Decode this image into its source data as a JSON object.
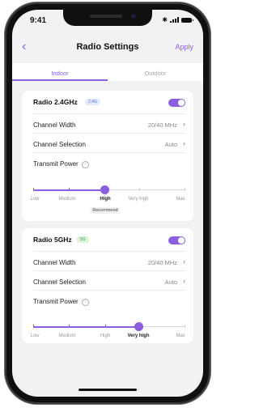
{
  "status_bar": {
    "time": "9:41"
  },
  "header": {
    "title": "Radio Settings",
    "back_icon": "chevron-left-icon",
    "apply_label": "Apply"
  },
  "tabs": [
    {
      "label": "Indoor",
      "selected": true
    },
    {
      "label": "Outdoor",
      "selected": false
    }
  ],
  "accent_color": "#8b5fe0",
  "power_levels": [
    "Low",
    "Medium",
    "High",
    "Very high",
    "Max"
  ],
  "recommend_label": "Recommend",
  "bands": [
    {
      "title": "Radio 2.4GHz",
      "badge": "2.4G",
      "enabled": true,
      "channel_width_label": "Channel Width",
      "channel_width_value": "20/40 MHz",
      "channel_selection_label": "Channel Selection",
      "channel_selection_value": "Auto",
      "transmit_power_label": "Transmit Power",
      "power_selected": "High"
    },
    {
      "title": "Radio 5GHz",
      "badge": "5G",
      "enabled": true,
      "channel_width_label": "Channel Width",
      "channel_width_value": "20/40 MHz",
      "channel_selection_label": "Channel Selection",
      "channel_selection_value": "Auto",
      "transmit_power_label": "Transmit Power",
      "power_selected": "Very high"
    }
  ]
}
